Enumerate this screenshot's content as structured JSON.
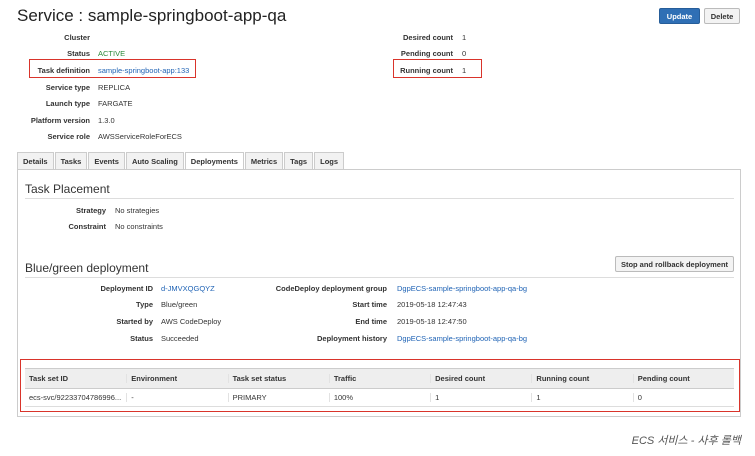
{
  "service_title": "Service : sample-springboot-app-qa",
  "buttons": {
    "update": "Update",
    "delete": "Delete"
  },
  "details_left": [
    {
      "key": "Cluster",
      "value": ""
    },
    {
      "key": "Status",
      "value": "ACTIVE"
    },
    {
      "key": "Task definition",
      "value": "sample-springboot-app:133"
    },
    {
      "key": "Service type",
      "value": "REPLICA"
    },
    {
      "key": "Launch type",
      "value": "FARGATE"
    },
    {
      "key": "Platform version",
      "value": "1.3.0"
    },
    {
      "key": "Service role",
      "value": "AWSServiceRoleForECS"
    }
  ],
  "details_right": [
    {
      "key": "Desired count",
      "value": "1"
    },
    {
      "key": "Pending count",
      "value": "0"
    },
    {
      "key": "Running count",
      "value": "1"
    }
  ],
  "tabs": [
    "Details",
    "Tasks",
    "Events",
    "Auto Scaling",
    "Deployments",
    "Metrics",
    "Tags",
    "Logs"
  ],
  "active_tab": "Deployments",
  "task_placement": {
    "title": "Task Placement",
    "strategy_label": "Strategy",
    "strategy_value": "No strategies",
    "constraint_label": "Constraint",
    "constraint_value": "No constraints"
  },
  "bluegreen": {
    "title": "Blue/green deployment",
    "rollback_button": "Stop and rollback deployment",
    "left": [
      {
        "key": "Deployment ID",
        "value": "d-JMVXQGQYZ"
      },
      {
        "key": "Type",
        "value": "Blue/green"
      },
      {
        "key": "Started by",
        "value": "AWS CodeDeploy"
      },
      {
        "key": "Status",
        "value": "Succeeded"
      }
    ],
    "right": [
      {
        "key": "CodeDeploy deployment group",
        "value": "DgpECS-sample-springboot-app-qa-bg"
      },
      {
        "key": "Start time",
        "value": "2019-05-18 12:47:43"
      },
      {
        "key": "End time",
        "value": "2019-05-18 12:47:50"
      },
      {
        "key": "Deployment history",
        "value": "DgpECS-sample-springboot-app-qa-bg"
      }
    ]
  },
  "taskset_table": {
    "columns": [
      "Task set ID",
      "Environment",
      "Task set status",
      "Traffic",
      "Desired count",
      "Running count",
      "Pending count"
    ],
    "rows": [
      [
        "ecs-svc/92233704786996...",
        "-",
        "PRIMARY",
        "100%",
        "1",
        "1",
        "0"
      ]
    ]
  },
  "caption": "ECS 서비스 - 사후 롤백",
  "colors": {
    "primary": "#2f6fb5",
    "highlight": "#d9342b",
    "link": "#1f63b5",
    "active": "#2a8a3a"
  }
}
